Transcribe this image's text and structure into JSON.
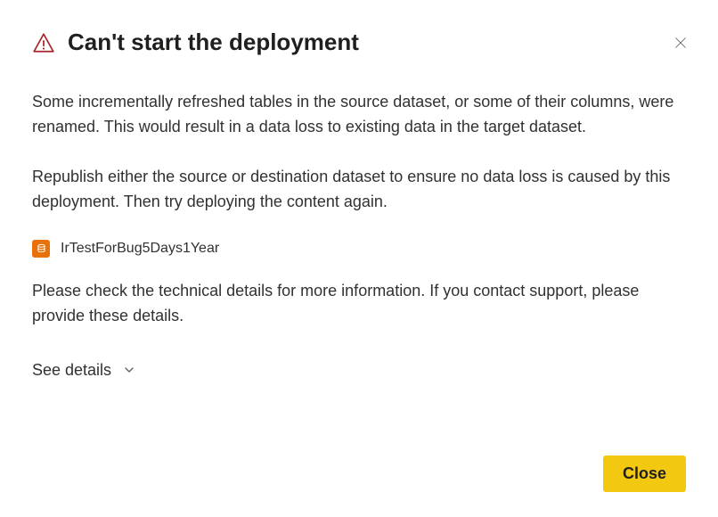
{
  "dialog": {
    "title": "Can't start the deployment",
    "paragraph1": "Some incrementally refreshed tables in the source dataset, or some of their columns, were renamed. This would result in a data loss to existing data in the target dataset.",
    "paragraph2": "Republish either the source or destination dataset to ensure no data loss is caused by this deployment. Then try deploying the content again.",
    "paragraph3": "Please check the technical details for more information. If you contact support, please provide these details.",
    "dataset_name": "IrTestForBug5Days1Year",
    "see_details_label": "See details",
    "close_button_label": "Close"
  },
  "colors": {
    "warning_icon": "#a4262c",
    "dataset_icon_bg": "#e8710a",
    "primary_button_bg": "#f2c811"
  }
}
